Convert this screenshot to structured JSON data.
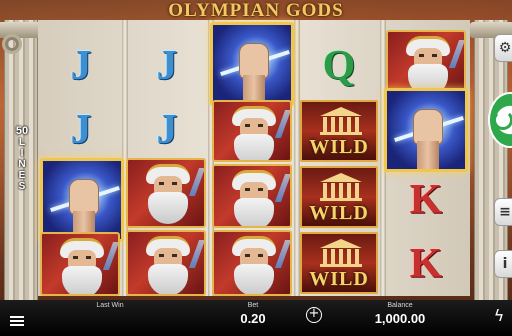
{
  "game": {
    "title": "OLYMPIAN GODS",
    "lines_count": "50",
    "lines_word": [
      "L",
      "I",
      "N",
      "E",
      "S"
    ]
  },
  "reels": {
    "symbols": [
      [
        "J",
        "J",
        "fist",
        "zeus"
      ],
      [
        "J",
        "J",
        "zeus",
        "zeus"
      ],
      [
        "fist",
        "zeus",
        "zeus",
        "zeus"
      ],
      [
        "Q",
        "WILD",
        "WILD",
        "WILD"
      ],
      [
        "zeus",
        "fist",
        "K",
        "K"
      ]
    ],
    "wild_label": "WILD"
  },
  "side_buttons": {
    "spin": "spin-button",
    "autoplay_icon": "coin-stack-icon",
    "info_label": "i"
  },
  "bottom_bar": {
    "last_win_label": "Last Win",
    "last_win_value": "",
    "bet_label": "Bet",
    "bet_value": "0.20",
    "balance_label": "Balance",
    "balance_value": "1,000.00"
  },
  "colors": {
    "title_gold": "#f2c860",
    "spin_green": "#2ea84a",
    "letter_J": "#3e8fd0",
    "letter_Q": "#2e9a48",
    "letter_K": "#c83030"
  }
}
